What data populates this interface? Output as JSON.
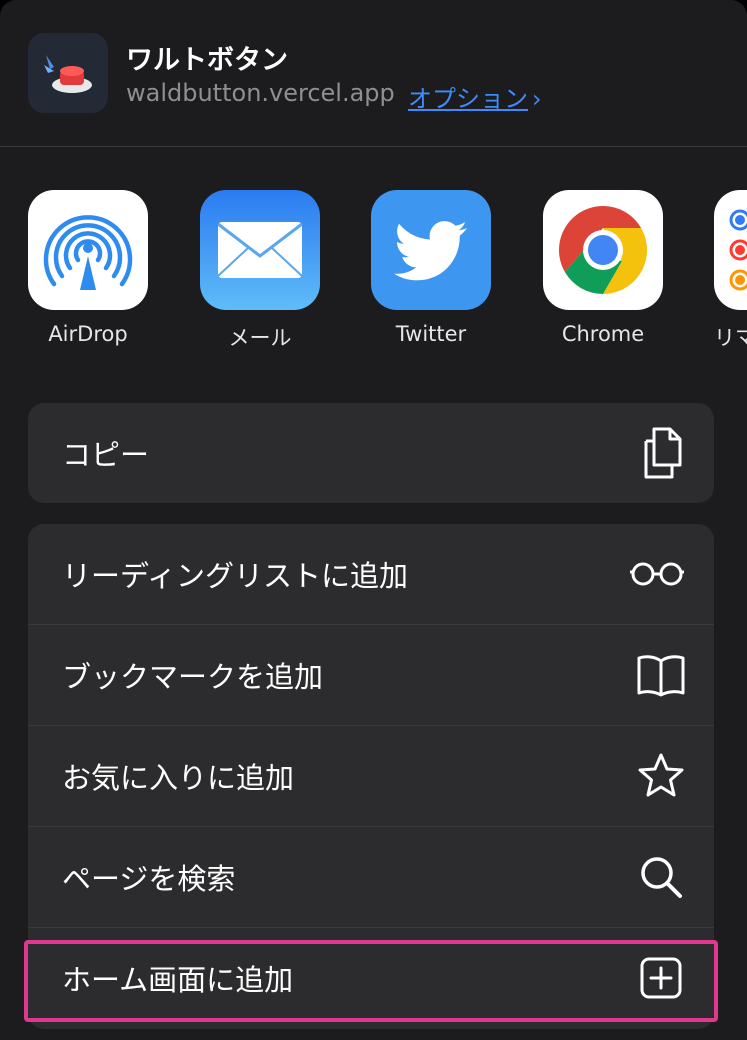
{
  "header": {
    "app_name": "ワルトボタン",
    "url": "waldbutton.vercel.app",
    "options_label": "オプション",
    "options_chevron": "›"
  },
  "share_apps": [
    {
      "label": "AirDrop",
      "icon": "airdrop-icon"
    },
    {
      "label": "メール",
      "icon": "mail-icon"
    },
    {
      "label": "Twitter",
      "icon": "twitter-icon"
    },
    {
      "label": "Chrome",
      "icon": "chrome-icon"
    },
    {
      "label": "リマ",
      "icon": "reminders-icon"
    }
  ],
  "actions_primary": [
    {
      "label": "コピー",
      "icon": "copy-icon"
    }
  ],
  "actions_secondary": [
    {
      "label": "リーディングリストに追加",
      "icon": "glasses-icon"
    },
    {
      "label": "ブックマークを追加",
      "icon": "book-icon"
    },
    {
      "label": "お気に入りに追加",
      "icon": "star-icon"
    },
    {
      "label": "ページを検索",
      "icon": "search-icon"
    },
    {
      "label": "ホーム画面に追加",
      "icon": "plus-square-icon"
    }
  ],
  "colors": {
    "sheet_bg": "#1c1c1e",
    "group_bg": "#2c2c2e",
    "link": "#3d8bfd",
    "highlight": "#e0388f"
  }
}
